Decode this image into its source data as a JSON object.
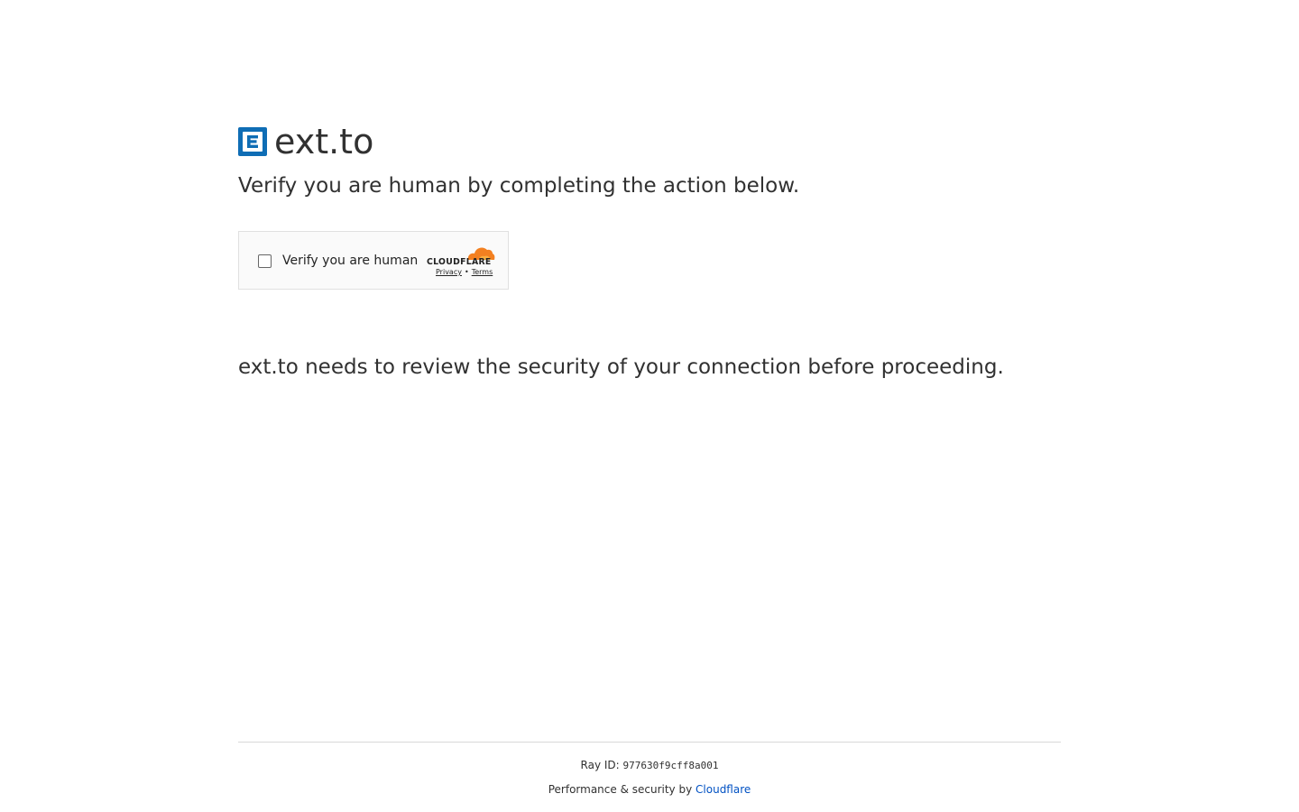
{
  "site": {
    "name": "ext.to",
    "favicon_letter": "E",
    "favicon_color": "#0f6db5"
  },
  "heading": "Verify you are human by completing the action below.",
  "challenge": {
    "checkbox_checked": false,
    "checkbox_label": "Verify you are human",
    "brand": "CLOUDFLARE",
    "brand_color": "#f38020",
    "privacy_link": "Privacy",
    "separator": "•",
    "terms_link": "Terms"
  },
  "review_text": "ext.to needs to review the security of your connection before proceeding.",
  "footer": {
    "ray_label": "Ray ID:",
    "ray_id": "977630f9cff8a001",
    "perf_label": "Performance & security by",
    "perf_link": "Cloudflare",
    "link_color": "#0051c3"
  }
}
